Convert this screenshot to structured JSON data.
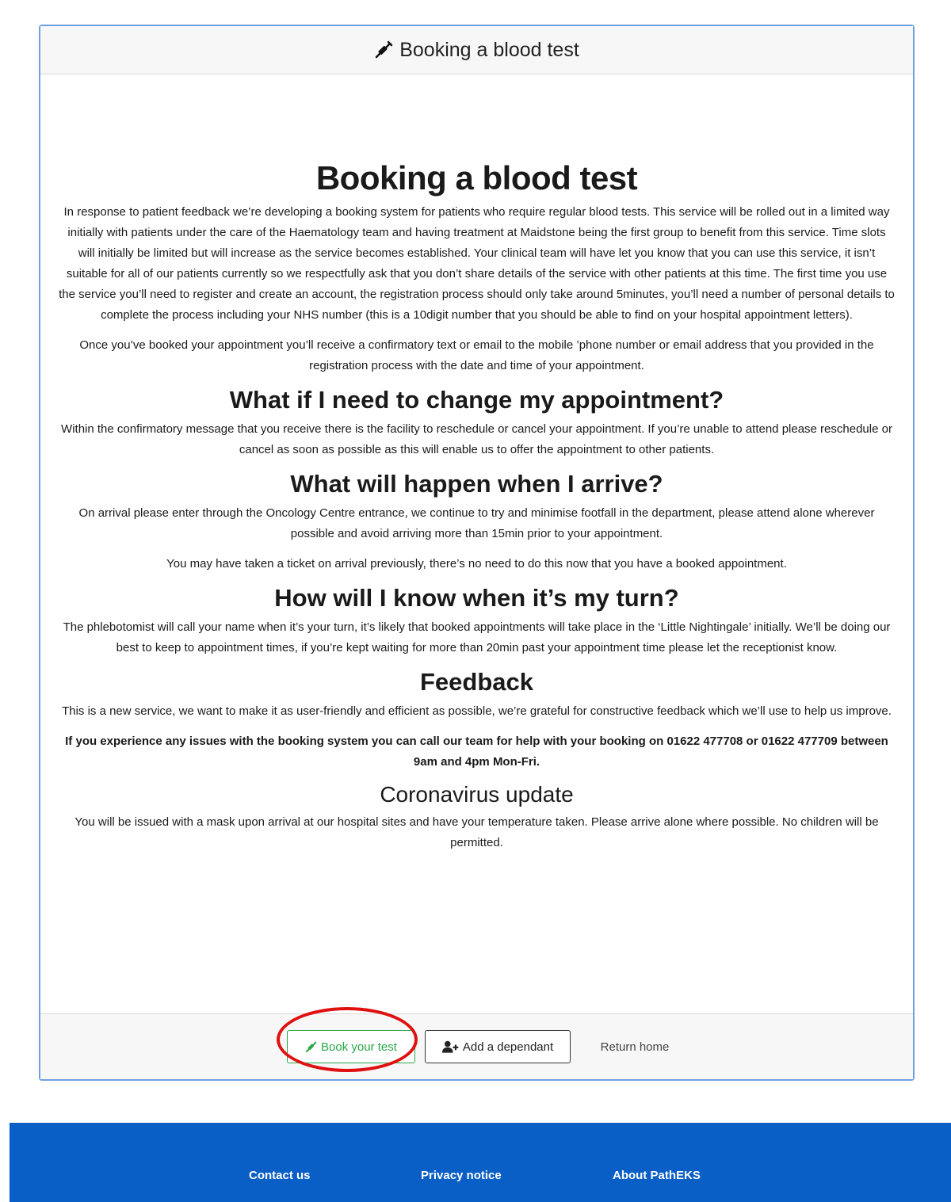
{
  "header": {
    "title": "Booking a blood test",
    "icon": "syringe-icon"
  },
  "main": {
    "title": "Booking a blood test",
    "intro_paragraphs": [
      "In response to patient feedback we’re developing a booking system for patients who require regular blood tests. This service will be rolled out in a limited way initially with patients under the care of the Haematology team and having treatment at Maidstone being the first group to benefit from this service. Time slots will initially be limited but will increase as the service becomes established. Your clinical team will have let you know that you can use this service, it isn’t suitable for all of our patients currently so we respectfully ask that you don’t share details of the service with other patients at this time. The first time you use the service you’ll need to register and create an account, the registration process should only take around 5minutes, you’ll need a number of personal details to complete the process including your NHS number (this is a 10digit number that you should be able to find on your hospital appointment letters).",
      "Once you’ve booked your appointment you’ll receive a confirmatory text or email to the mobile ’phone number or email address that you provided in the registration process with the date and time of your appointment."
    ],
    "change_heading": "What if I need to change my appointment?",
    "change_text": "Within the confirmatory message that you receive there is the facility to reschedule or cancel your appointment. If you’re unable to attend please reschedule or cancel as soon as possible as this will enable us to offer the appointment to other patients.",
    "arrive_heading": "What will happen when I arrive?",
    "arrive_text_1": "On arrival please enter through the Oncology Centre entrance, we continue to try and minimise footfall in the department, please attend alone wherever possible and avoid arriving more than 15min prior to your appointment.",
    "arrive_text_2": "You may have taken a ticket on arrival previously, there’s no need to do this now that you have a booked appointment.",
    "turn_heading": "How will I know when it’s my turn?",
    "turn_text": "The phlebotomist will call your name when it’s your turn, it’s likely that booked appointments will take place in the ‘Little Nightingale’ initially. We’ll be doing our best to keep to appointment times, if you’re kept waiting for more than 20min past your appointment time please let the receptionist know.",
    "feedback_heading": "Feedback",
    "feedback_text": "This is a new service, we want to make it as user-friendly and efficient as possible, we’re grateful for constructive feedback which we’ll use to help us improve.",
    "help_text": "If you experience any issues with the booking system you can call our team for help with your booking on 01622 477708 or 01622 477709 between 9am and 4pm Mon-Fri.",
    "corona_heading": "Coronavirus update",
    "corona_text": "You will be issued with a mask upon arrival at our hospital sites and have your temperature taken.  Please arrive alone where possible.  No children will be permitted."
  },
  "actions": {
    "book_label": "Book your test",
    "dependant_label": "Add a dependant",
    "home_label": "Return home"
  },
  "footer": {
    "contact": "Contact us",
    "privacy": "Privacy notice",
    "about": "About PathEKS"
  },
  "colors": {
    "card_border": "#6fa1e0",
    "book_green": "#28a745",
    "highlight_red": "#e01010",
    "footer_blue": "#0a5fc7"
  }
}
